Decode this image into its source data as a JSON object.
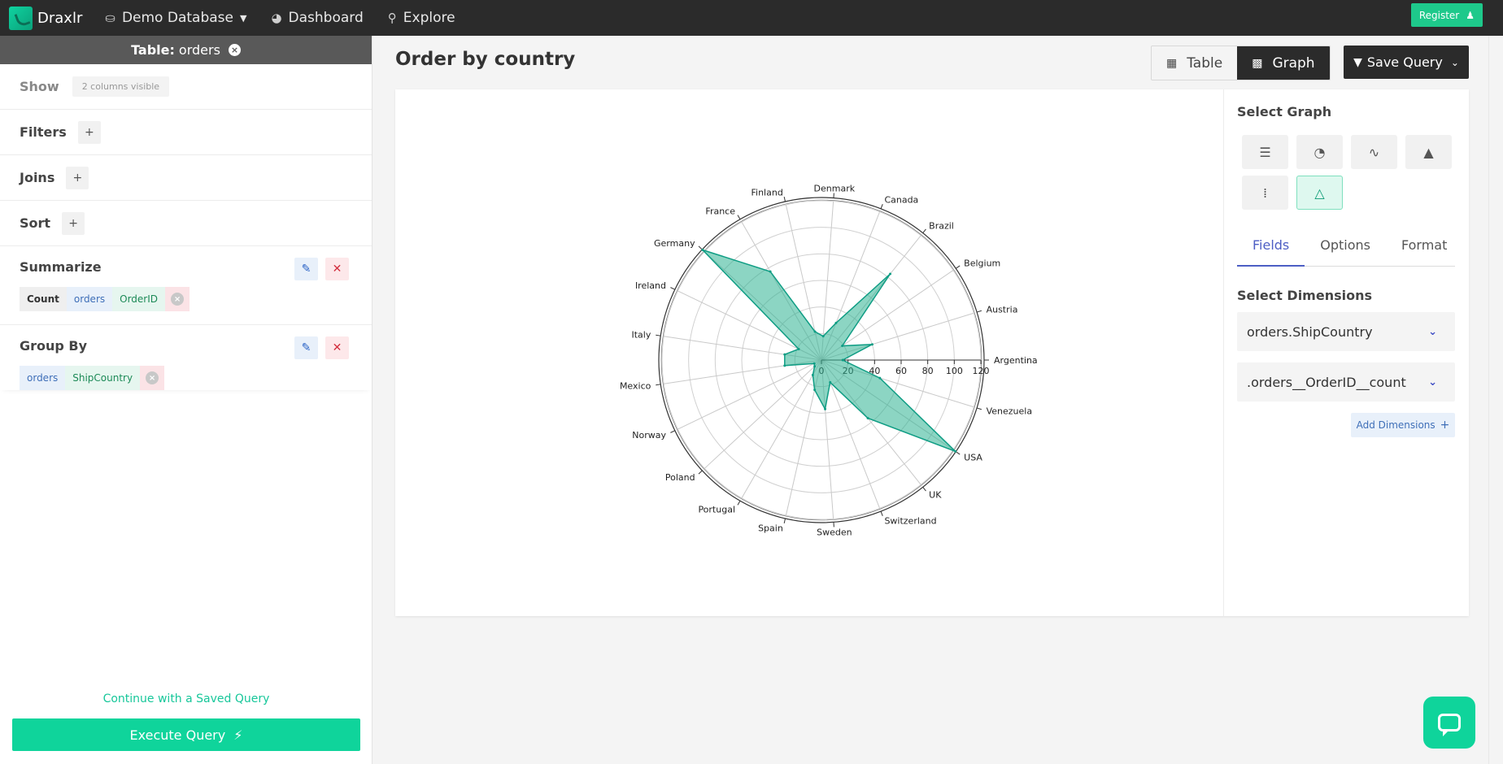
{
  "nav": {
    "brand": "Draxlr",
    "database": "Demo Database",
    "dashboard": "Dashboard",
    "explore": "Explore",
    "register": "Register"
  },
  "left": {
    "table_label": "Table:",
    "table_name": "orders",
    "show_label": "Show",
    "show_value": "2 columns visible",
    "filters": "Filters",
    "joins": "Joins",
    "sort": "Sort",
    "summarize": "Summarize",
    "summarize_chips": {
      "fn": "Count",
      "table": "orders",
      "column": "OrderID"
    },
    "group_by": "Group By",
    "group_chips": {
      "table": "orders",
      "column": "ShipCountry"
    },
    "continue": "Continue with a Saved Query",
    "execute": "Execute Query"
  },
  "main": {
    "title": "Order by country",
    "view_table": "Table",
    "view_graph": "Graph",
    "save_query": "Save Query"
  },
  "side": {
    "select_graph": "Select Graph",
    "graph_types": [
      "bar-icon",
      "pie-icon",
      "line-icon",
      "area-icon",
      "scatter-icon",
      "radar-icon"
    ],
    "active_graph": "radar-icon",
    "tabs": [
      "Fields",
      "Options",
      "Format"
    ],
    "active_tab": "Fields",
    "select_dimensions": "Select Dimensions",
    "dim1": "orders.ShipCountry",
    "dim2": ".orders__OrderID__count",
    "add_dimensions": "Add Dimensions"
  },
  "chart_data": {
    "type": "radar",
    "title": "",
    "categories": [
      "Argentina",
      "Austria",
      "Belgium",
      "Brazil",
      "Canada",
      "Denmark",
      "Finland",
      "France",
      "Germany",
      "Ireland",
      "Italy",
      "Mexico",
      "Norway",
      "Poland",
      "Portugal",
      "Spain",
      "Sweden",
      "Switzerland",
      "UK",
      "USA",
      "Venezuela"
    ],
    "values": [
      16,
      40,
      19,
      83,
      30,
      18,
      22,
      77,
      122,
      19,
      28,
      28,
      6,
      7,
      13,
      23,
      37,
      18,
      56,
      122,
      46
    ],
    "radial_ticks": [
      0,
      20,
      40,
      60,
      80,
      100,
      120
    ],
    "rmax": 120,
    "fill_color": "#2db391",
    "stroke_color": "#0f9d84"
  }
}
